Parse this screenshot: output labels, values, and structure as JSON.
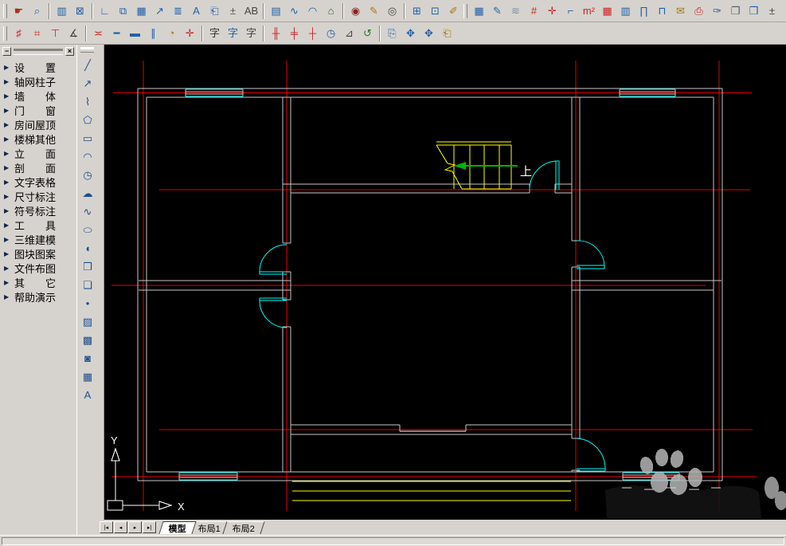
{
  "toolbars": {
    "row1": [
      "~",
      {
        "n": "screen-menu",
        "g": "☛",
        "c": "#a33327"
      },
      {
        "n": "preview-zoom",
        "g": "⌕",
        "c": "#1f5fa8"
      },
      "|",
      {
        "n": "project-browser",
        "g": "▥",
        "c": "#1f5fa8"
      },
      {
        "n": "open-drawing",
        "g": "⊠",
        "c": "#1f5fa8"
      },
      "|",
      {
        "n": "axis-tool",
        "g": "∟",
        "c": "#1f5fa8"
      },
      {
        "n": "standard-column",
        "g": "⧉",
        "c": "#1f5fa8"
      },
      {
        "n": "axis-dim",
        "g": "▦",
        "c": "#1f5fa8"
      },
      {
        "n": "leader-label",
        "g": "↗",
        "c": "#1f5fa8"
      },
      {
        "n": "elevation-marks",
        "g": "≣",
        "c": "#1f5fa8"
      },
      {
        "n": "text-style",
        "g": "A",
        "c": "#1f5fa8"
      },
      {
        "n": "insert-door",
        "g": "⎗",
        "c": "#1f5fa8"
      },
      {
        "n": "level-mark",
        "g": "±",
        "c": "#555555"
      },
      {
        "n": "rename-blocks",
        "g": "AB",
        "c": "#444444"
      },
      "|",
      {
        "n": "panel-grid",
        "g": "▤",
        "c": "#1f5fa8"
      },
      {
        "n": "wave-line",
        "g": "∿",
        "c": "#1f5fa8"
      },
      {
        "n": "dome-arc",
        "g": "◠",
        "c": "#1f5fa8"
      },
      {
        "n": "house-label",
        "g": "⌂",
        "c": "#2e6b2e"
      },
      "|",
      {
        "n": "hide-object",
        "g": "◉",
        "c": "#8b2222"
      },
      {
        "n": "edit-object",
        "g": "✎",
        "c": "#a8780a"
      },
      {
        "n": "show-object",
        "g": "◎",
        "c": "#444444"
      },
      "|",
      {
        "n": "four-pane-view",
        "g": "⊞",
        "c": "#1f5fa8"
      },
      {
        "n": "pane-point",
        "g": "⊡",
        "c": "#1f5fa8"
      },
      {
        "n": "measure-tool",
        "g": "✐",
        "c": "#a8780a"
      },
      "~",
      {
        "n": "grid-adjust",
        "g": "▦",
        "c": "#1f5fa8"
      },
      {
        "n": "sheet-edit",
        "g": "✎",
        "c": "#1f5fa8"
      },
      {
        "n": "layer-stack",
        "g": "≋",
        "c": "#7a8ea8"
      },
      {
        "n": "axis-grid-red",
        "g": "#",
        "c": "#cc2222"
      },
      {
        "n": "axis-cross",
        "g": "✛",
        "c": "#cc2222"
      },
      {
        "n": "step-section",
        "g": "⌐",
        "c": "#1f5fa8"
      },
      {
        "n": "area-m2",
        "g": "m²",
        "c": "#cc2222"
      },
      {
        "n": "area-table",
        "g": "▦",
        "c": "#cc2222"
      },
      {
        "n": "column-pane",
        "g": "▥",
        "c": "#1f5fa8"
      },
      {
        "n": "door-schedule",
        "g": "∏",
        "c": "#1f5fa8"
      },
      {
        "n": "window-schedule",
        "g": "⊓",
        "c": "#1f5fa8"
      },
      {
        "n": "envelope",
        "g": "✉",
        "c": "#a8780a"
      },
      {
        "n": "seal-stamp",
        "g": "⎙",
        "c": "#cc2222"
      },
      {
        "n": "brush-match",
        "g": "✑",
        "c": "#1f5fa8"
      },
      {
        "n": "book-pages",
        "g": "❐",
        "c": "#555566"
      },
      {
        "n": "window-shade",
        "g": "❒",
        "c": "#1f5fa8"
      },
      {
        "n": "level-funnel",
        "g": "±",
        "c": "#444444"
      }
    ],
    "row2": [
      "~",
      {
        "n": "draw-axis-grid",
        "g": "♯",
        "c": "#cc2222"
      },
      {
        "n": "axis-bubbles",
        "g": "⌗",
        "c": "#cc2222"
      },
      {
        "n": "axis-single",
        "g": "⊤",
        "c": "#cc2222"
      },
      {
        "n": "axis-angle",
        "g": "∡",
        "c": "#444444"
      },
      "|",
      {
        "n": "draw-wall",
        "g": "≍",
        "c": "#cc2222"
      },
      {
        "n": "single-line-wall",
        "g": "━",
        "c": "#1f5fa8"
      },
      {
        "n": "wall-section",
        "g": "▬",
        "c": "#1f5fa8"
      },
      {
        "n": "offset-parallel",
        "g": "∥",
        "c": "#1f5fa8"
      },
      {
        "n": "door-swing",
        "g": "◔",
        "c": "#a8780a"
      },
      {
        "n": "wall-cross",
        "g": "✛",
        "c": "#cc2222"
      },
      "|",
      {
        "n": "text-write",
        "g": "字",
        "c": "#333333"
      },
      {
        "n": "text-mark",
        "g": "字",
        "c": "#1f5fa8"
      },
      {
        "n": "text-paragraph",
        "g": "字",
        "c": "#444444"
      },
      "|",
      {
        "n": "dim-linear",
        "g": "╫",
        "c": "#cc2222"
      },
      {
        "n": "dim-continue",
        "g": "╪",
        "c": "#cc2222"
      },
      {
        "n": "dim-point",
        "g": "┼",
        "c": "#cc2222"
      },
      {
        "n": "dim-angular",
        "g": "◷",
        "c": "#1f5fa8"
      },
      {
        "n": "dim-protractor",
        "g": "⊿",
        "c": "#444444"
      },
      {
        "n": "dim-rotate",
        "g": "↺",
        "c": "#2a7a2a"
      },
      "|",
      {
        "n": "copy-object",
        "g": "⎘",
        "c": "#1f5fa8"
      },
      {
        "n": "pan-view",
        "g": "✥",
        "c": "#1f5fa8"
      },
      {
        "n": "move-object",
        "g": "✥",
        "c": "#1f5fa8"
      },
      {
        "n": "paste-clipboard",
        "g": "⎗",
        "c": "#a8780a"
      }
    ]
  },
  "sidebar": {
    "header": {
      "minimize_glyph": "−",
      "close_glyph": "×"
    },
    "arrow_glyph": "▶",
    "items": [
      {
        "label": "设　　置"
      },
      {
        "label": "轴网柱子"
      },
      {
        "label": "墙　　体"
      },
      {
        "label": "门　　窗"
      },
      {
        "label": "房间屋顶"
      },
      {
        "label": "楼梯其他"
      },
      {
        "label": "立　　面"
      },
      {
        "label": "剖　　面"
      },
      {
        "label": "文字表格"
      },
      {
        "label": "尺寸标注"
      },
      {
        "label": "符号标注"
      },
      {
        "label": "工　　具"
      },
      {
        "label": "三维建模"
      },
      {
        "label": "图块图案"
      },
      {
        "label": "文件布图"
      },
      {
        "label": "其　　它"
      },
      {
        "label": "帮助演示"
      }
    ]
  },
  "draw_toolbar": {
    "items": [
      {
        "n": "line",
        "g": "╱"
      },
      {
        "n": "construction-line",
        "g": "↗"
      },
      {
        "n": "polyline",
        "g": "⌇"
      },
      {
        "n": "polygon",
        "g": "⬠"
      },
      {
        "n": "rectangle",
        "g": "▭"
      },
      {
        "n": "arc",
        "g": "◠"
      },
      {
        "n": "circle",
        "g": "◷"
      },
      {
        "n": "revision-cloud",
        "g": "☁"
      },
      {
        "n": "spline",
        "g": "∿"
      },
      {
        "n": "ellipse",
        "g": "⬭"
      },
      {
        "n": "ellipse-arc",
        "g": "◖"
      },
      {
        "n": "insert-block",
        "g": "❒"
      },
      {
        "n": "make-block",
        "g": "❏"
      },
      {
        "n": "point",
        "g": "•"
      },
      {
        "n": "hatch",
        "g": "▨"
      },
      {
        "n": "gradient",
        "g": "▩"
      },
      {
        "n": "region",
        "g": "◙"
      },
      {
        "n": "table",
        "g": "▦"
      },
      {
        "n": "mtext",
        "g": "A"
      }
    ]
  },
  "canvas": {
    "colors": {
      "background": "#000000",
      "axis": "#e60000",
      "wall": "#c8c8c8",
      "opening": "#ffffff",
      "fixture": "#00ffff",
      "stair": "#ffff00",
      "arrow": "#00b400",
      "ucs": "#ffffff"
    },
    "labels": {
      "stair_up": "上",
      "ucs_x": "X",
      "ucs_y": "Y"
    }
  },
  "tabbar": {
    "nav": [
      {
        "name": "first-tab",
        "glyph": "|◂"
      },
      {
        "name": "prev-tab",
        "glyph": "◂"
      },
      {
        "name": "next-tab",
        "glyph": "▸"
      },
      {
        "name": "last-tab",
        "glyph": "▸|"
      }
    ],
    "tabs": [
      {
        "label": "模型",
        "active": true
      },
      {
        "label": "布局1",
        "active": false
      },
      {
        "label": "布局2",
        "active": false
      }
    ]
  }
}
